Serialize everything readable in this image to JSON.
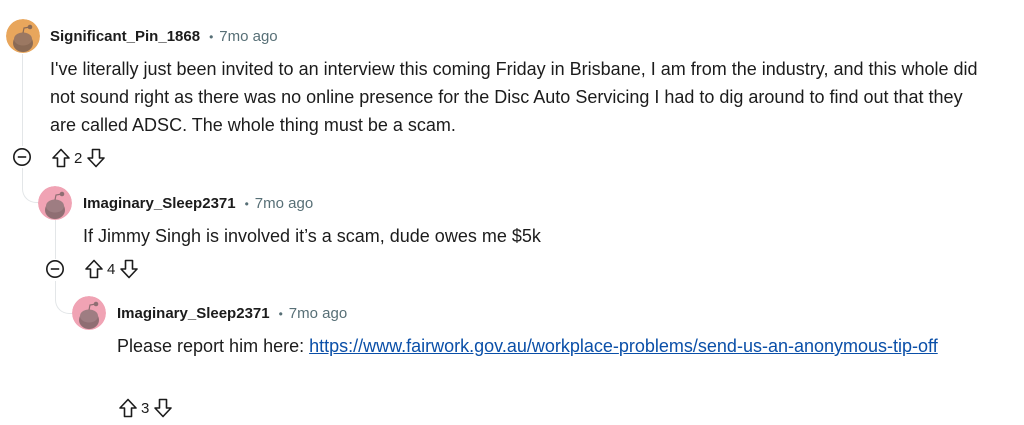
{
  "comments": [
    {
      "username": "Significant_Pin_1868",
      "separator": "•",
      "time": "7mo ago",
      "body": "I've literally just been invited to an interview this coming Friday in Brisbane, I am from the industry, and this whole did not sound right as there was no online presence for the Disc Auto Servicing I had to dig around to find out that they are called ADSC. The whole thing must be a scam.",
      "votes": "2",
      "avatar_color": "#e8a65c"
    },
    {
      "username": "Imaginary_Sleep2371",
      "separator": "•",
      "time": "7mo ago",
      "body": "If Jimmy Singh is involved it’s a scam, dude owes me $5k",
      "votes": "4",
      "avatar_color": "#f0a3b4"
    },
    {
      "username": "Imaginary_Sleep2371",
      "separator": "•",
      "time": "7mo ago",
      "body_prefix": "Please report him here: ",
      "link": "https://www.fairwork.gov.au/workplace-problems/send-us-an-anonymous-tip-off",
      "votes": "3",
      "avatar_color": "#f0a3b4"
    }
  ],
  "icons": {
    "upvote": "arrow-up-outline-icon",
    "downvote": "arrow-down-outline-icon",
    "collapse": "minus-circle-icon"
  },
  "colors": {
    "link": "#0a4fa8",
    "meta": "#576f76",
    "thread_line": "#e3e6e8"
  }
}
